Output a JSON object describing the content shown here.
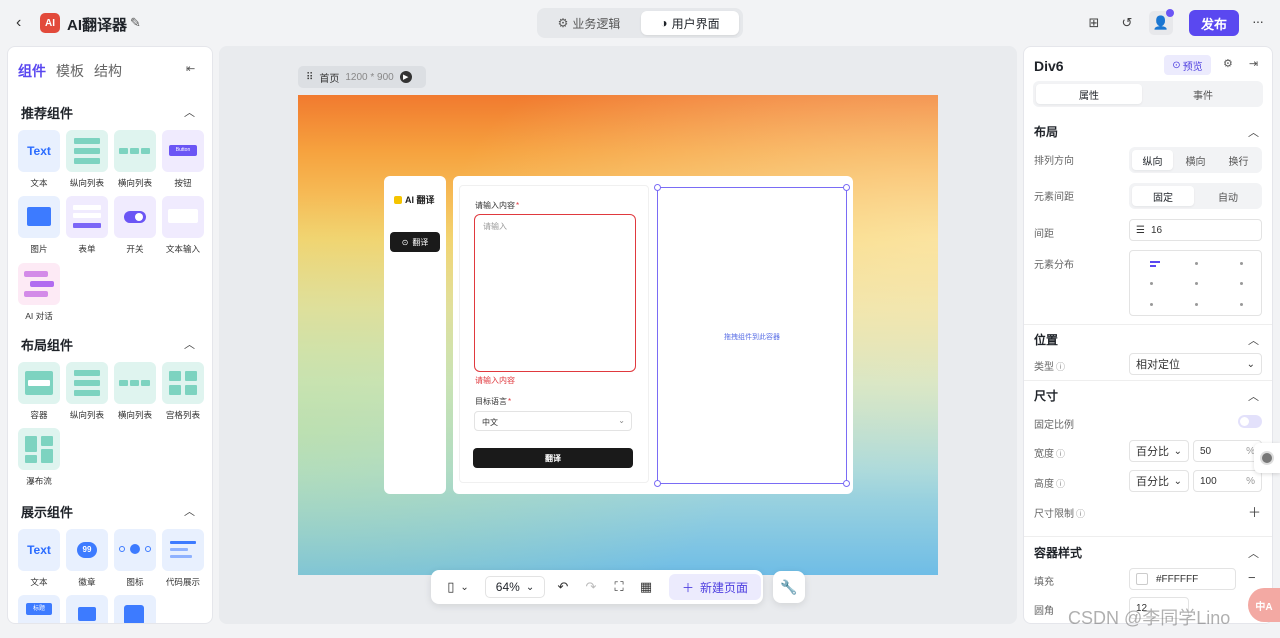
{
  "header": {
    "app_title": "AI翻译器",
    "logo_text": "AI",
    "modes": [
      {
        "label": "业务逻辑"
      },
      {
        "label": "用户界面"
      }
    ],
    "publish_label": "发布"
  },
  "left_panel": {
    "tabs": [
      "组件",
      "模板",
      "结构"
    ],
    "sections": [
      {
        "title": "推荐组件",
        "items": [
          "文本",
          "纵向列表",
          "横向列表",
          "按钮",
          "图片",
          "表单",
          "开关",
          "文本输入",
          "AI 对话"
        ]
      },
      {
        "title": "布局组件",
        "items": [
          "容器",
          "纵向列表",
          "横向列表",
          "宫格列表",
          "瀑布流"
        ]
      },
      {
        "title": "展示组件",
        "items": [
          "文本",
          "徽章",
          "图标",
          "代码展示"
        ]
      }
    ],
    "tile_texts": {
      "text": "Text",
      "button": "Button",
      "badge": "99",
      "tag": "标题"
    }
  },
  "canvas": {
    "page_name": "首页",
    "page_size": "1200 * 900",
    "zoom": "64%",
    "new_page_label": "新建页面",
    "preview": {
      "nav_title": "AI 翻译",
      "nav_button": "翻译",
      "input_label": "请输入内容",
      "input_placeholder": "请输入",
      "input_error": "请输入内容",
      "lang_label": "目标语言",
      "lang_value": "中文",
      "submit_label": "翻译",
      "drop_hint": "拖拽组件到此容器"
    }
  },
  "right_panel": {
    "title": "Div6",
    "preview_label": "预览",
    "tabs": [
      "属性",
      "事件"
    ],
    "layout": {
      "title": "布局",
      "direction_label": "排列方向",
      "direction_options": [
        "纵向",
        "横向",
        "换行"
      ],
      "gap_mode_label": "元素间距",
      "gap_mode_options": [
        "固定",
        "自动"
      ],
      "gap_label": "间距",
      "gap_value": "16",
      "distribution_label": "元素分布"
    },
    "position": {
      "title": "位置",
      "type_label": "类型",
      "type_value": "相对定位"
    },
    "size": {
      "title": "尺寸",
      "ratio_label": "固定比例",
      "width_label": "宽度",
      "width_unit": "百分比",
      "width_value": "50",
      "width_suffix": "%",
      "height_label": "高度",
      "height_unit": "百分比",
      "height_value": "100",
      "height_suffix": "%",
      "limit_label": "尺寸限制"
    },
    "container_style": {
      "title": "容器样式",
      "fill_label": "填充",
      "fill_value": "#FFFFFF",
      "radius_label": "圆角",
      "radius_value": "12"
    }
  },
  "watermark": "CSDN @李同学Lino",
  "corner_text": "中A",
  "colors": {
    "accent": "#5a48f0",
    "error": "#e0393e",
    "dark_button": "#1a1a1a"
  }
}
